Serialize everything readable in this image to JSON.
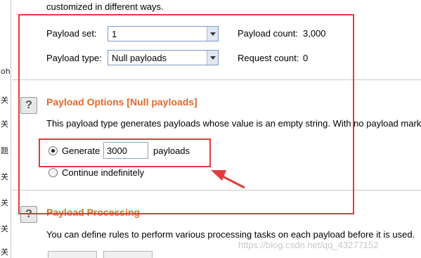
{
  "intro": {
    "text": "customized in different ways."
  },
  "left_strip": {
    "chars": [
      "oh",
      "关",
      "关",
      "题",
      "关",
      "关",
      "关",
      "关"
    ]
  },
  "payload_sets": {
    "set_label": "Payload set:",
    "set_value": "1",
    "count_label": "Payload count:",
    "count_value": "3,000",
    "type_label": "Payload type:",
    "type_value": "Null payloads",
    "request_label": "Request count:",
    "request_value": "0"
  },
  "payload_options": {
    "title": "Payload Options [Null payloads]",
    "description": "This payload type generates payloads whose value is an empty string. With no payload mark",
    "generate_label": "Generate",
    "generate_value": "3000",
    "generate_suffix": "payloads",
    "continue_label": "Continue indefinitely",
    "selected": "generate"
  },
  "payload_processing": {
    "title": "Payload Processing",
    "description": "You can define rules to perform various processing tasks on each payload before it is used."
  },
  "help_icon_glyph": "?",
  "watermark": "https://blog.csdn.net/qq_43277152",
  "colors": {
    "section_title": "#e06a2c",
    "annotation": "#e23b3b"
  }
}
